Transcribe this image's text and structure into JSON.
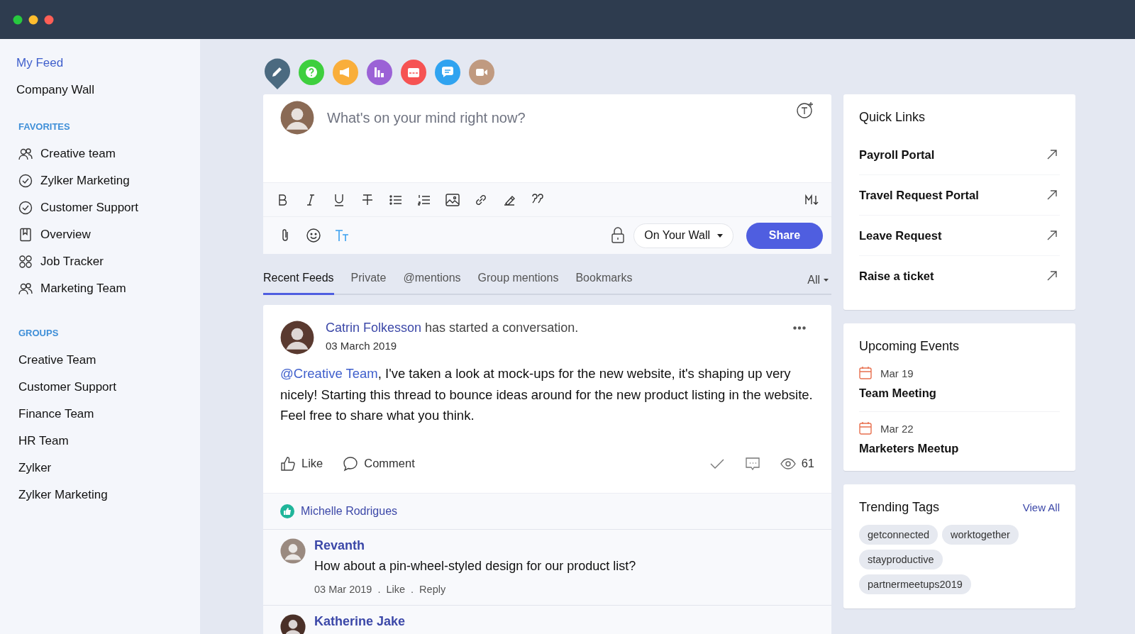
{
  "sidebar": {
    "items": [
      {
        "label": "My Feed",
        "selected": true
      },
      {
        "label": "Company Wall",
        "selected": false
      }
    ],
    "sections": [
      {
        "title": "FAVORITES",
        "items": [
          {
            "label": "Creative team",
            "kind": "group"
          },
          {
            "label": "Zylker Marketing",
            "kind": "check"
          },
          {
            "label": "Customer Support",
            "kind": "check"
          },
          {
            "label": "Overview",
            "kind": "board"
          },
          {
            "label": "Job Tracker",
            "kind": "apps"
          },
          {
            "label": "Marketing Team",
            "kind": "group"
          }
        ]
      },
      {
        "title": "GROUPS",
        "items": [
          {
            "label": "Creative Team",
            "kind": "plain"
          },
          {
            "label": "Customer Support",
            "kind": "plain"
          },
          {
            "label": "Finance Team",
            "kind": "plain"
          },
          {
            "label": "HR Team",
            "kind": "plain"
          },
          {
            "label": "Zylker",
            "kind": "plain"
          },
          {
            "label": "Zylker Marketing",
            "kind": "plain"
          }
        ]
      }
    ]
  },
  "post_types": [
    {
      "kind": "pencil",
      "color": "#4b6a80",
      "selected": true
    },
    {
      "kind": "question",
      "color": "#3ecf3e",
      "selected": false
    },
    {
      "kind": "megaphone",
      "color": "#f9ae3b",
      "selected": false
    },
    {
      "kind": "chart",
      "color": "#9b62d6",
      "selected": false
    },
    {
      "kind": "calendar",
      "color": "#f65353",
      "selected": false
    },
    {
      "kind": "chat",
      "color": "#30a3f0",
      "selected": false
    },
    {
      "kind": "video",
      "color": "#c09a80",
      "selected": false
    }
  ],
  "composer": {
    "placeholder": "What's on your mind right now?",
    "visibility": "On Your Wall",
    "share": "Share"
  },
  "feed_tabs": {
    "tabs": [
      {
        "label": "Recent Feeds",
        "selected": true
      },
      {
        "label": "Private",
        "selected": false
      },
      {
        "label": "@mentions",
        "selected": false
      },
      {
        "label": "Group mentions",
        "selected": false
      },
      {
        "label": "Bookmarks",
        "selected": false
      }
    ],
    "filter": "All"
  },
  "post": {
    "author": "Catrin Folkesson",
    "action": "has started a conversation.",
    "date": "03 March 2019",
    "mention": "@Creative Team",
    "body": ", I've taken a look at mock-ups for the new website, it's shaping up very nicely! Starting this thread to bounce ideas around for the new product listing in the website. Feel free to share what you think.",
    "like": "Like",
    "comment": "Comment",
    "views": "61",
    "liked_by": "Michelle Rodrigues",
    "comments": [
      {
        "author": "Revanth",
        "text": "How about a pin-wheel-styled design for our product list?",
        "date": "03 Mar 2019",
        "separator": ".",
        "actions": [
          "Like",
          "Reply"
        ]
      },
      {
        "author": "Katherine Jake"
      }
    ]
  },
  "quick_links": {
    "title": "Quick Links",
    "items": [
      "Payroll Portal",
      "Travel Request Portal",
      "Leave Request",
      "Raise a ticket"
    ]
  },
  "upcoming_events": {
    "title": "Upcoming Events",
    "items": [
      {
        "date": "Mar 19",
        "title": "Team Meeting"
      },
      {
        "date": "Mar 22",
        "title": "Marketers Meetup"
      }
    ]
  },
  "trending_tags": {
    "title": "Trending Tags",
    "view_all": "View All",
    "tags": [
      "getconnected",
      "worktogether",
      "stayproductive",
      "partnermeetups2019"
    ]
  }
}
